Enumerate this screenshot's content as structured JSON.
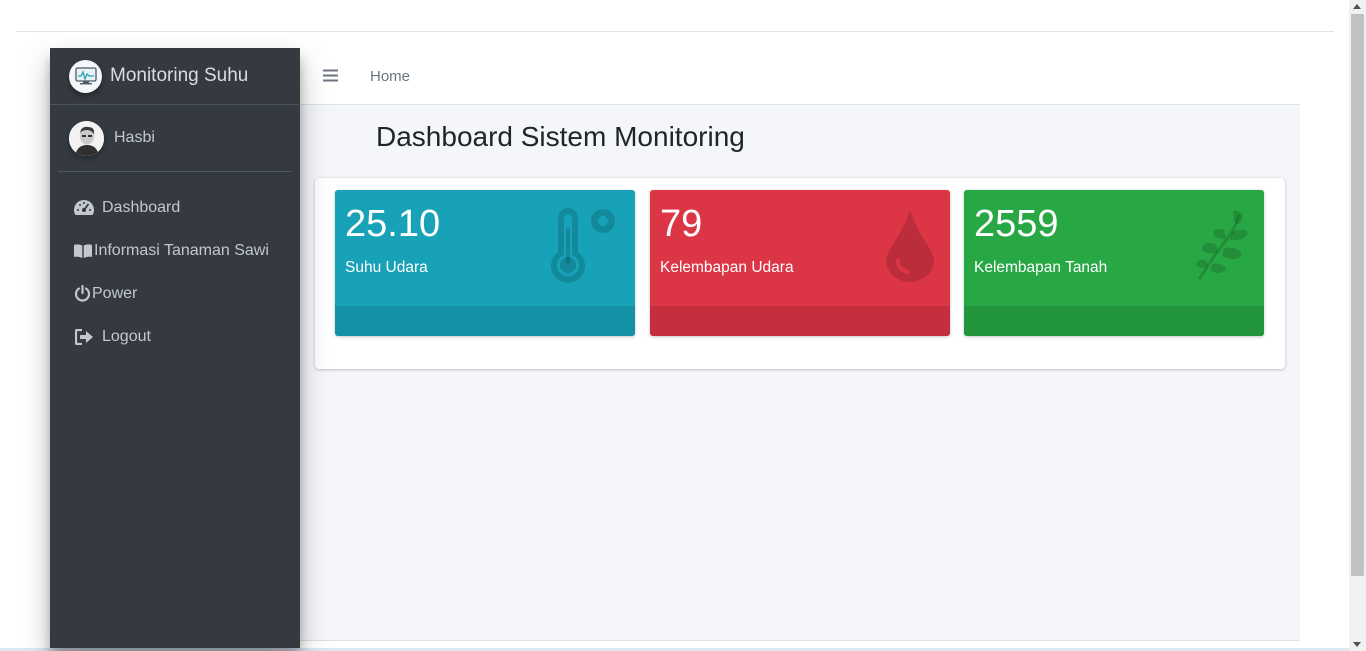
{
  "brand": {
    "title": "Monitoring Suhu"
  },
  "user": {
    "name": "Hasbi"
  },
  "sidebar": {
    "items": [
      {
        "label": "Dashboard",
        "icon": "tachometer-icon"
      },
      {
        "label": "Informasi Tanaman Sawi",
        "icon": "book-icon"
      },
      {
        "label": "Power",
        "icon": "power-icon"
      },
      {
        "label": "Logout",
        "icon": "sign-out-icon"
      }
    ]
  },
  "navbar": {
    "home_label": "Home"
  },
  "page": {
    "title": "Dashboard Sistem Monitoring"
  },
  "stats": [
    {
      "value": "25.10",
      "label": "Suhu Udara",
      "icon": "thermometer-icon",
      "color": "#17a2b8"
    },
    {
      "value": "79",
      "label": "Kelembapan Udara",
      "icon": "droplet-icon",
      "color": "#dc3545"
    },
    {
      "value": "2559",
      "label": "Kelembapan Tanah",
      "icon": "leaf-icon",
      "color": "#28a745"
    }
  ],
  "colors": {
    "sidebar_bg": "#343a40",
    "content_bg": "#f4f6f9",
    "info": "#17a2b8",
    "danger": "#dc3545",
    "success": "#28a745"
  }
}
